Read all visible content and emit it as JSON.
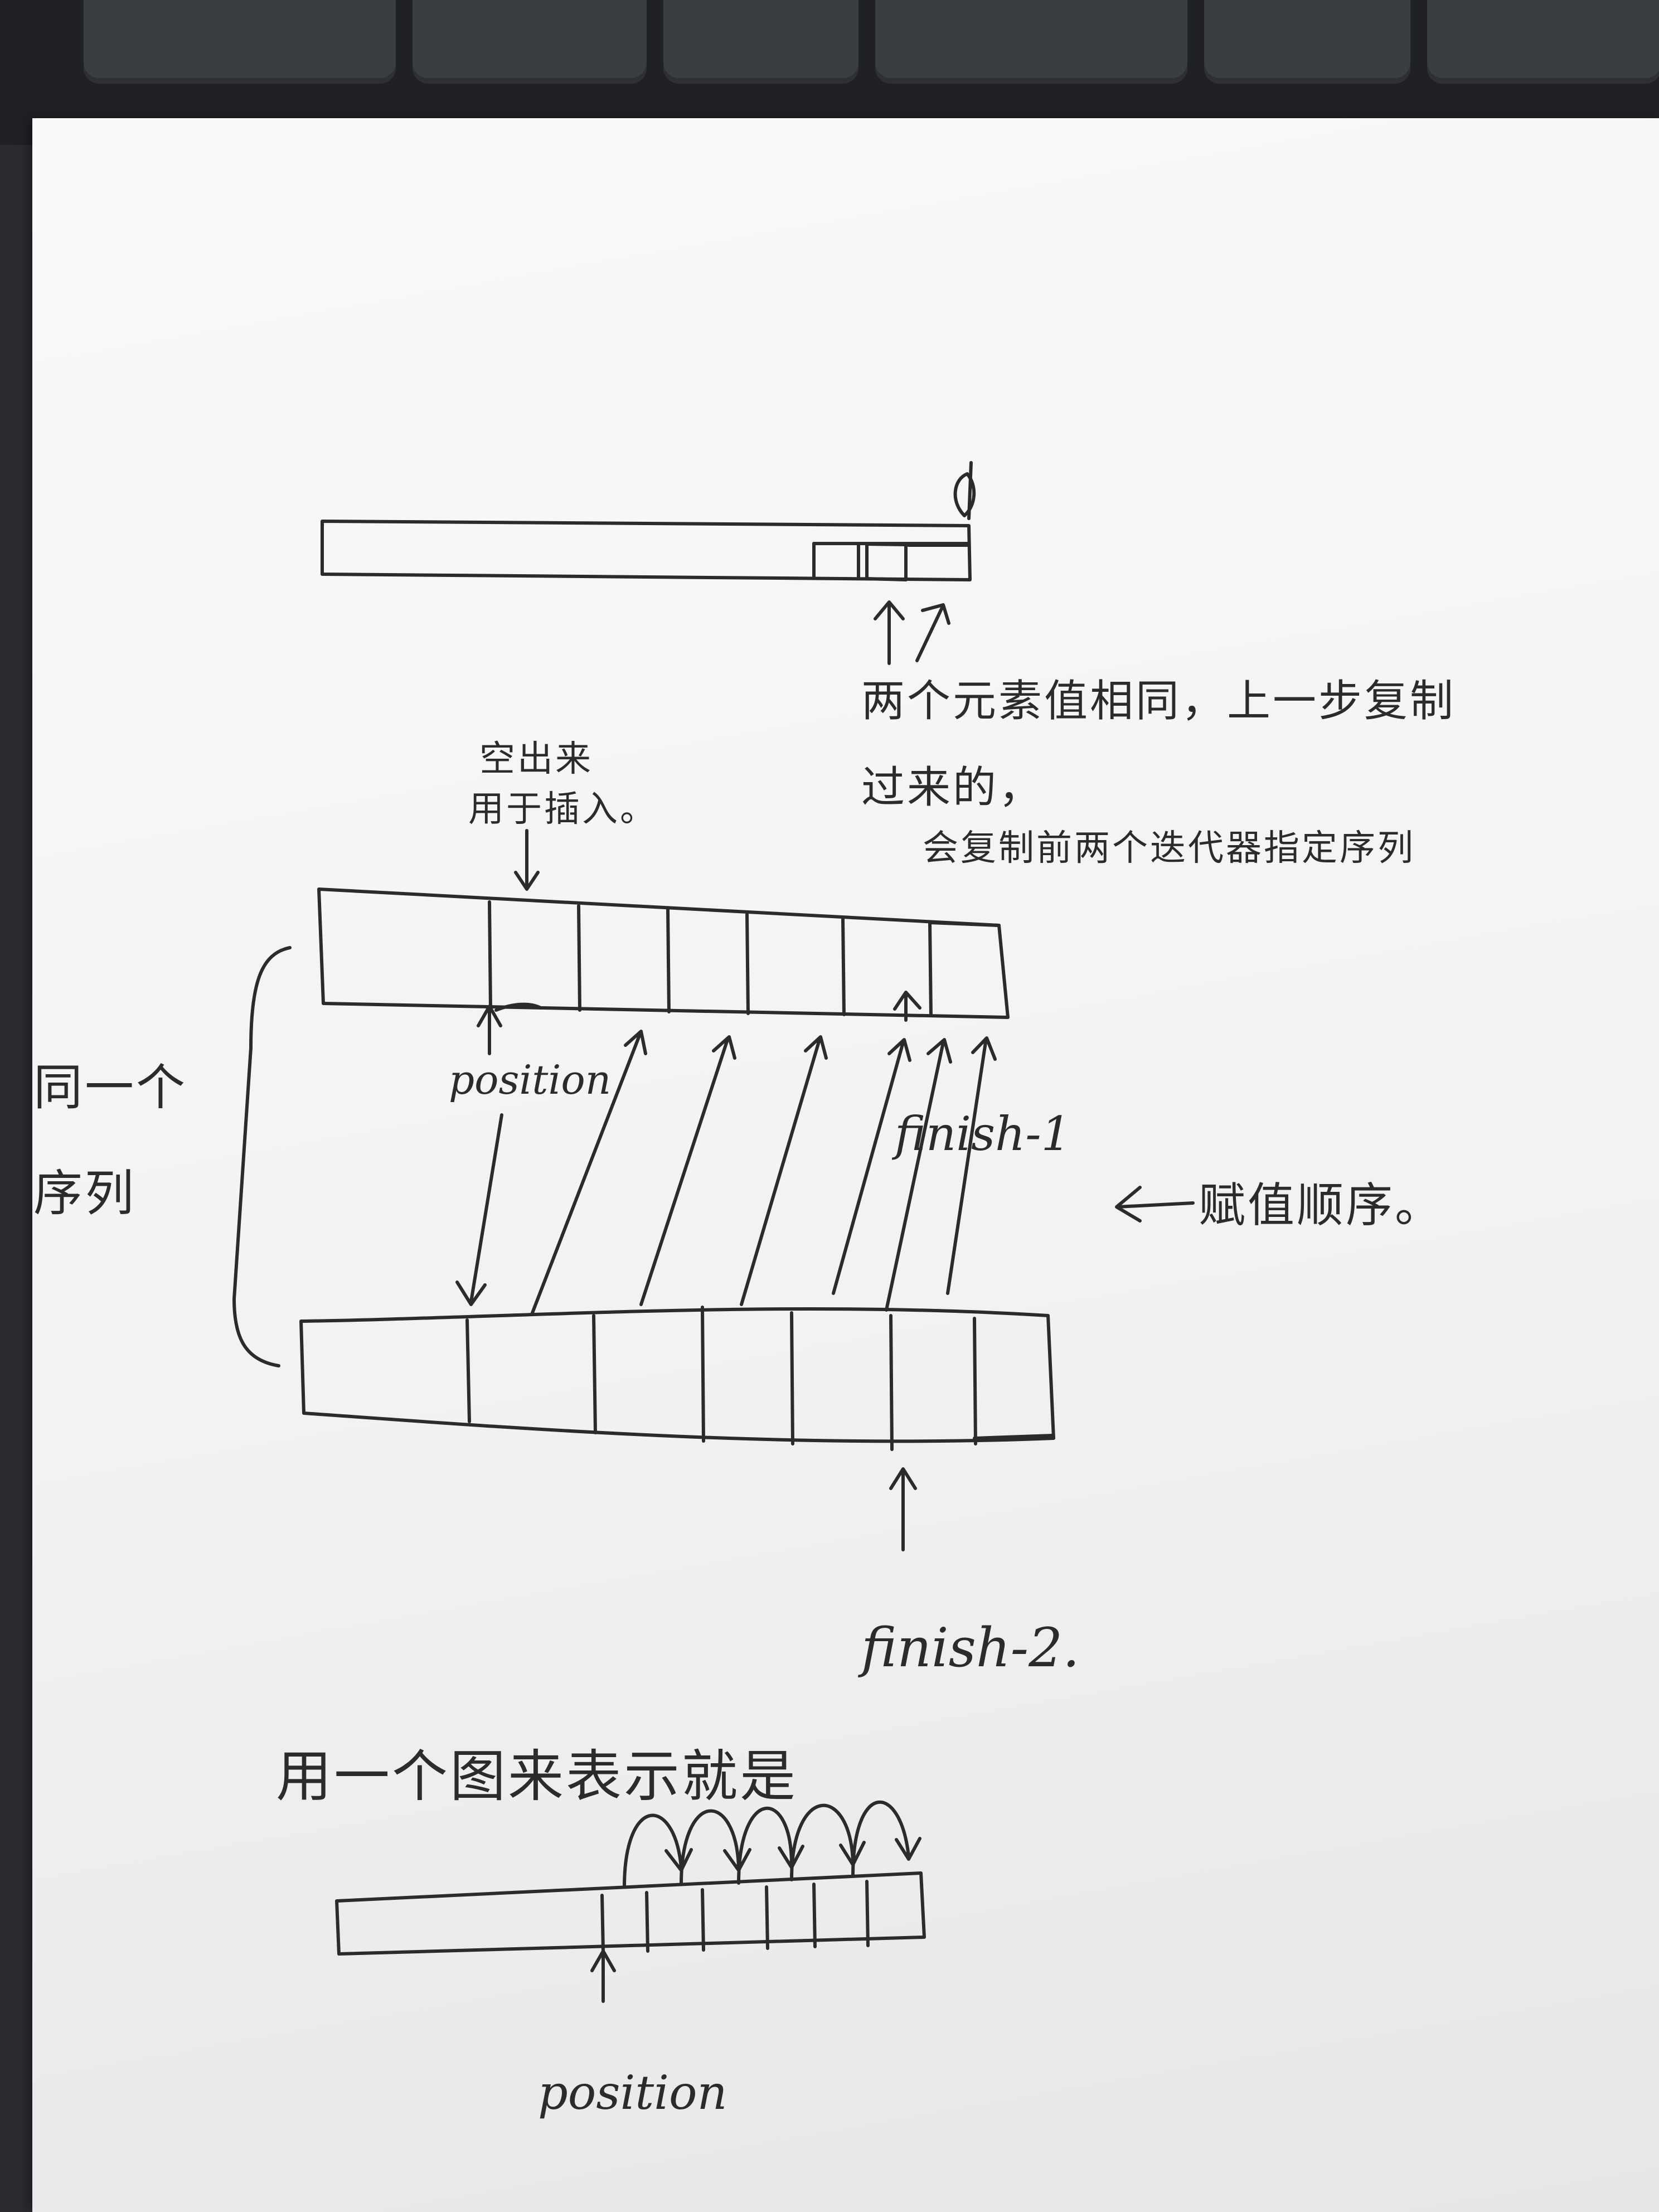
{
  "notes": {
    "same_values": "两个元素值相同，上一步复制",
    "copied_over": "过来的，",
    "copy_iterators": "会复制前两个迭代器指定序列",
    "vacate": "空出来",
    "for_insert": "用于插入。",
    "same_1": "同一个",
    "same_2": "序列",
    "assign_order": "赋值顺序。",
    "one_figure": "用一个图来表示就是"
  },
  "labels": {
    "position_1": "position",
    "finish_1": "finish-1",
    "finish_2": "finish-2.",
    "position_2": "position"
  },
  "colors": {
    "ink": "#2b2b2b",
    "paper": "#f5f5f5"
  }
}
